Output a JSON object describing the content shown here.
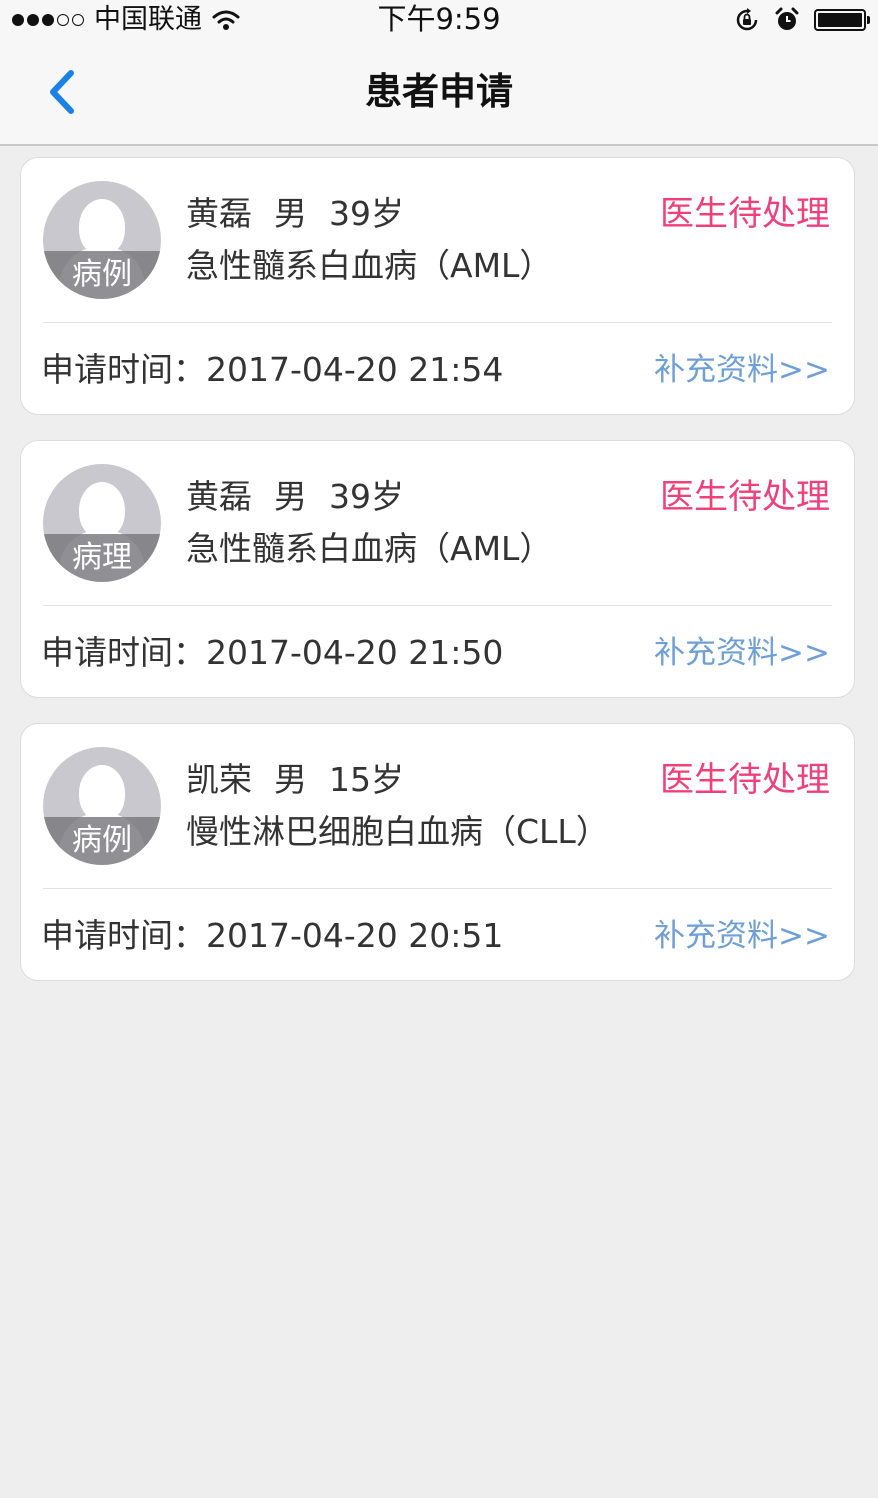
{
  "status_bar": {
    "carrier": "中国联通",
    "time": "下午9:59"
  },
  "nav": {
    "title": "患者申请"
  },
  "colors": {
    "status_pending": "#f0407a",
    "link": "#6e9fd6",
    "nav_accent": "#1a82e6"
  },
  "applications": [
    {
      "avatar_tag": "病例",
      "name": "黄磊",
      "gender": "男",
      "age": "39岁",
      "diagnosis": "急性髓系白血病（AML）",
      "status": "医生待处理",
      "time_label": "申请时间：",
      "time": "2017-04-20 21:54",
      "action": "补充资料>>"
    },
    {
      "avatar_tag": "病理",
      "name": "黄磊",
      "gender": "男",
      "age": "39岁",
      "diagnosis": "急性髓系白血病（AML）",
      "status": "医生待处理",
      "time_label": "申请时间：",
      "time": "2017-04-20 21:50",
      "action": "补充资料>>"
    },
    {
      "avatar_tag": "病例",
      "name": "凯荣",
      "gender": "男",
      "age": "15岁",
      "diagnosis": "慢性淋巴细胞白血病（CLL）",
      "status": "医生待处理",
      "time_label": "申请时间：",
      "time": "2017-04-20 20:51",
      "action": "补充资料>>"
    }
  ]
}
